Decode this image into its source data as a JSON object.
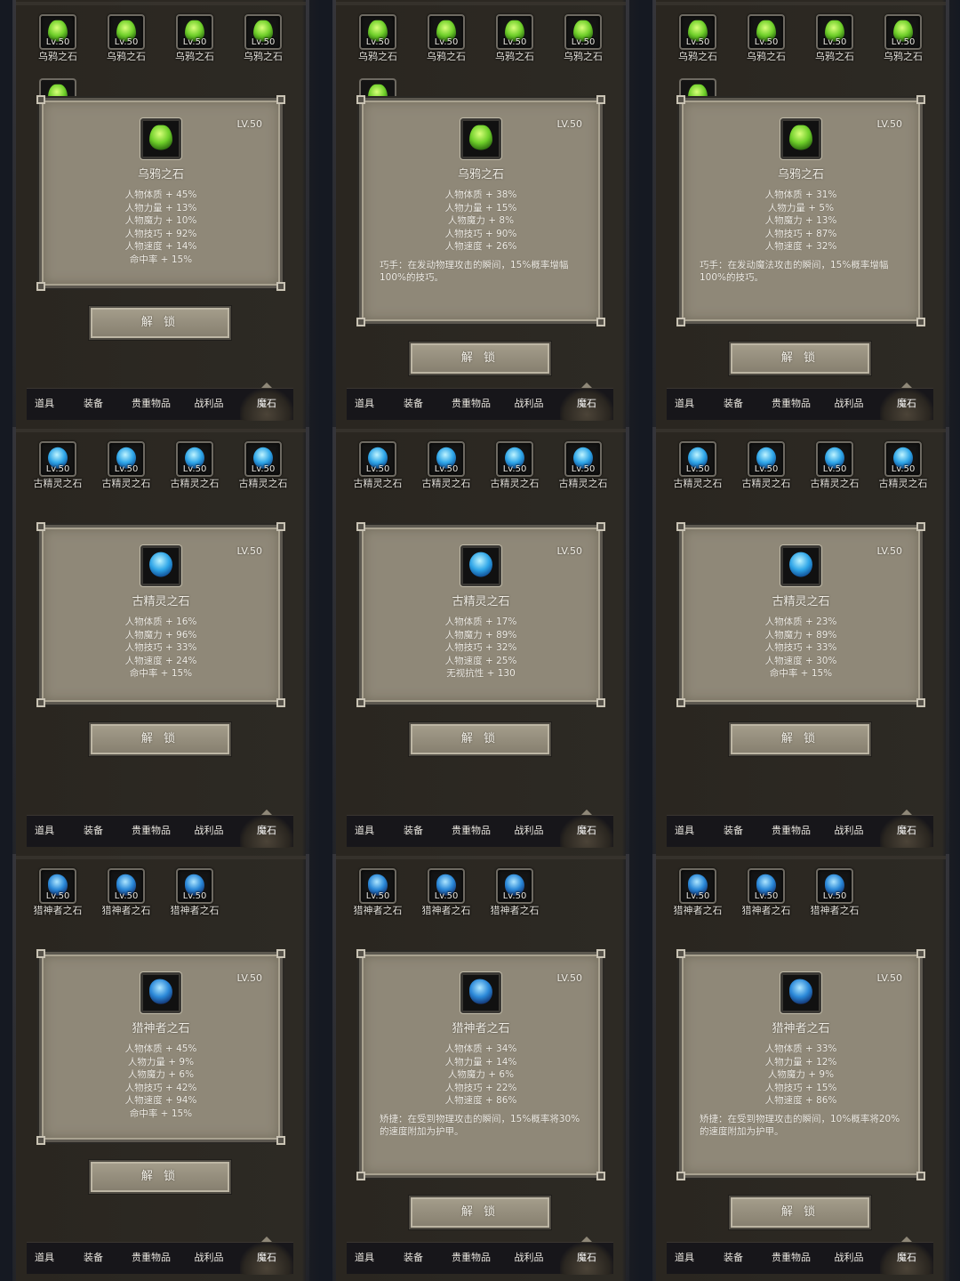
{
  "tabs": [
    "道具",
    "装备",
    "贵重物品",
    "战利品",
    "魔石"
  ],
  "active_tab": "魔石",
  "unlock_label": "解 锁",
  "panels": [
    {
      "stone": "乌鸦之石",
      "gem": "green",
      "level": "LV.50",
      "slot_level": "Lv.50",
      "slots": 4,
      "peek": true,
      "stats": [
        "人物体质 + 45%",
        "人物力量 + 13%",
        "人物魔力 + 10%",
        "人物技巧 + 92%",
        "人物速度 + 14%",
        "命中率 + 15%"
      ],
      "desc": ""
    },
    {
      "stone": "乌鸦之石",
      "gem": "green",
      "level": "LV.50",
      "slot_level": "Lv.50",
      "slots": 4,
      "peek": true,
      "stats": [
        "人物体质 + 38%",
        "人物力量 + 15%",
        "人物魔力 + 8%",
        "人物技巧 + 90%",
        "人物速度 + 26%"
      ],
      "desc": "巧手：在发动物理攻击的瞬间，15%概率增幅100%的技巧。"
    },
    {
      "stone": "乌鸦之石",
      "gem": "green",
      "level": "LV.50",
      "slot_level": "Lv.50",
      "slots": 4,
      "peek": true,
      "stats": [
        "人物体质 + 31%",
        "人物力量 + 5%",
        "人物魔力 + 13%",
        "人物技巧 + 87%",
        "人物速度 + 32%"
      ],
      "desc": "巧手：在发动魔法攻击的瞬间，15%概率增幅100%的技巧。"
    },
    {
      "stone": "古精灵之石",
      "gem": "blue",
      "level": "LV.50",
      "slot_level": "Lv.50",
      "slots": 4,
      "peek": false,
      "stats": [
        "人物体质 + 16%",
        "人物魔力 + 96%",
        "人物技巧 + 33%",
        "人物速度 + 24%",
        "命中率 + 15%"
      ],
      "desc": ""
    },
    {
      "stone": "古精灵之石",
      "gem": "blue",
      "level": "LV.50",
      "slot_level": "Lv.50",
      "slots": 4,
      "peek": false,
      "stats": [
        "人物体质 + 17%",
        "人物魔力 + 89%",
        "人物技巧 + 32%",
        "人物速度 + 25%",
        "无视抗性 + 130"
      ],
      "desc": ""
    },
    {
      "stone": "古精灵之石",
      "gem": "blue",
      "level": "LV.50",
      "slot_level": "Lv.50",
      "slots": 4,
      "peek": false,
      "stats": [
        "人物体质 + 23%",
        "人物魔力 + 89%",
        "人物技巧 + 33%",
        "人物速度 + 30%",
        "命中率 + 15%"
      ],
      "desc": ""
    },
    {
      "stone": "猎神者之石",
      "gem": "dblue",
      "level": "LV.50",
      "slot_level": "Lv.50",
      "slots": 3,
      "peek": false,
      "stats": [
        "人物体质 + 45%",
        "人物力量 + 9%",
        "人物魔力 + 6%",
        "人物技巧 + 42%",
        "人物速度 + 94%",
        "命中率 + 15%"
      ],
      "desc": ""
    },
    {
      "stone": "猎神者之石",
      "gem": "dblue",
      "level": "LV.50",
      "slot_level": "Lv.50",
      "slots": 3,
      "peek": false,
      "stats": [
        "人物体质 + 34%",
        "人物力量 + 14%",
        "人物魔力 + 6%",
        "人物技巧 + 22%",
        "人物速度 + 86%"
      ],
      "desc": "矫捷：在受到物理攻击的瞬间，15%概率将30%的速度附加为护甲。"
    },
    {
      "stone": "猎神者之石",
      "gem": "dblue",
      "level": "LV.50",
      "slot_level": "Lv.50",
      "slots": 3,
      "peek": false,
      "stats": [
        "人物体质 + 33%",
        "人物力量 + 12%",
        "人物魔力 + 9%",
        "人物技巧 + 15%",
        "人物速度 + 86%"
      ],
      "desc": "矫捷：在受到物理攻击的瞬间，10%概率将20%的速度附加为护甲。"
    }
  ]
}
